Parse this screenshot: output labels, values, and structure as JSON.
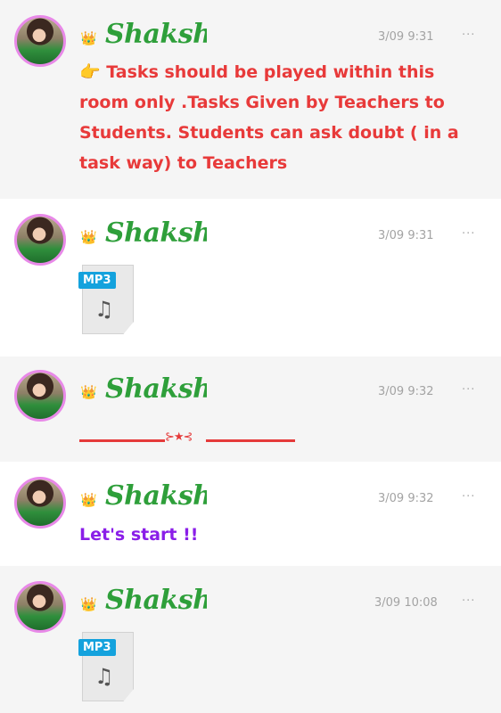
{
  "messages": [
    {
      "type": "text",
      "sender": "Shakshi",
      "crown": "👑",
      "time": "3/09 9:31",
      "more": "···",
      "emoji": "👉",
      "text": " Tasks should be played within this room only .Tasks Given by Teachers to Students. Students can ask doubt ( in a task way) to Teachers"
    },
    {
      "type": "file",
      "sender": "Shakshi",
      "crown": "👑",
      "time": "3/09 9:31",
      "more": "···",
      "badge": "MP3",
      "icon": "music-note-icon"
    },
    {
      "type": "divider",
      "sender": "Shakshi",
      "crown": "👑",
      "time": "3/09 9:32",
      "more": "···",
      "ornament": "⊱★⊰"
    },
    {
      "type": "text",
      "sender": "Shakshi",
      "crown": "👑",
      "time": "3/09 9:32",
      "more": "···",
      "text": "Let's start !!"
    },
    {
      "type": "file",
      "sender": "Shakshi",
      "crown": "👑",
      "time": "3/09 10:08",
      "more": "···",
      "badge": "MP3",
      "icon": "music-note-icon"
    }
  ],
  "colors": {
    "name": "#2e9f3a",
    "red": "#e83a3a",
    "purple": "#8a1ee8",
    "mp3_badge": "#14a2dd",
    "avatar_ring": "#e889e8"
  }
}
